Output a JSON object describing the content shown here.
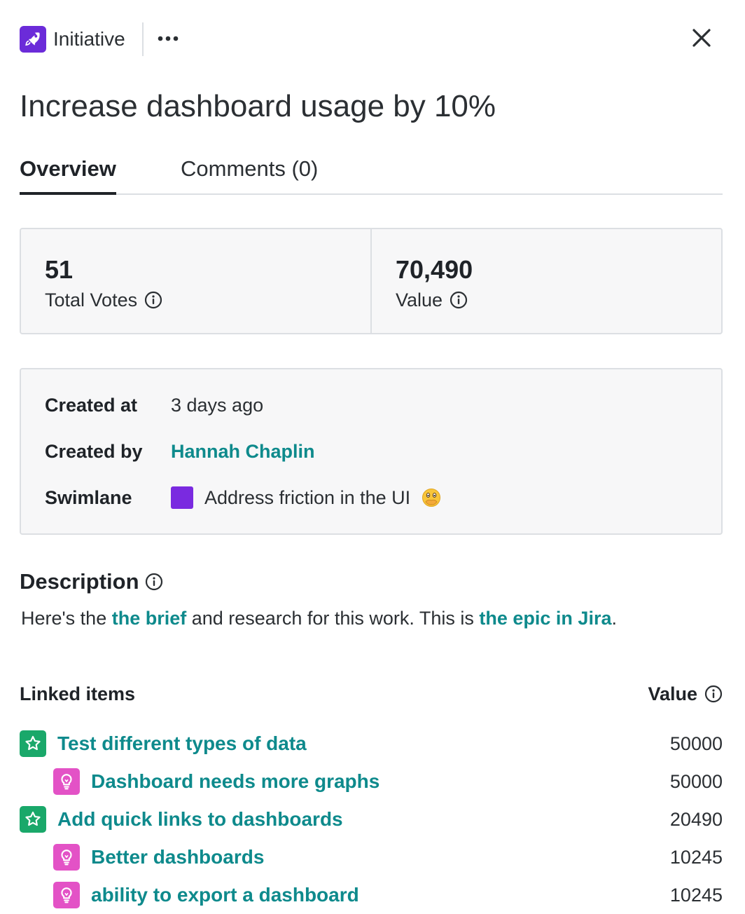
{
  "header": {
    "type_label": "Initiative",
    "type_icon": "rocket-icon",
    "more_icon": "more-horizontal-icon",
    "close_icon": "close-icon",
    "accent_color": "#6b2bd9"
  },
  "title": "Increase dashboard usage by 10%",
  "tabs": [
    {
      "label": "Overview",
      "active": true
    },
    {
      "label": "Comments (0)",
      "active": false
    }
  ],
  "stats": {
    "total_votes": {
      "value": "51",
      "label": "Total Votes"
    },
    "value": {
      "value": "70,490",
      "label": "Value"
    }
  },
  "details": {
    "created_at": {
      "label": "Created at",
      "value": "3 days ago"
    },
    "created_by": {
      "label": "Created by",
      "value": "Hannah Chaplin"
    },
    "swimlane": {
      "label": "Swimlane",
      "value": "Address friction in the UI",
      "color": "#7a2ae0",
      "emoji": "face-with-hand-over-mouth"
    }
  },
  "description": {
    "heading": "Description",
    "text_1": "Here's the ",
    "link_1": "the brief",
    "text_2": " and research for this work. This is ",
    "link_2": "the epic in Jira",
    "text_3": "."
  },
  "linked_items": {
    "title": "Linked items",
    "value_heading": "Value",
    "items": [
      {
        "name": "Test different types of data",
        "value": "50000",
        "kind": "feature",
        "icon": "star-icon",
        "level": 0
      },
      {
        "name": "Dashboard needs more graphs",
        "value": "50000",
        "kind": "idea",
        "icon": "lightbulb-icon",
        "level": 1
      },
      {
        "name": "Add quick links to dashboards",
        "value": "20490",
        "kind": "feature",
        "icon": "star-icon",
        "level": 0
      },
      {
        "name": "Better dashboards",
        "value": "10245",
        "kind": "idea",
        "icon": "lightbulb-icon",
        "level": 1
      },
      {
        "name": "ability to export a dashboard",
        "value": "10245",
        "kind": "idea",
        "icon": "lightbulb-icon",
        "level": 1
      }
    ]
  },
  "colors": {
    "link": "#0e8a8c",
    "feature_icon_bg": "#1aa86a",
    "idea_icon_bg": "#e352c6"
  }
}
